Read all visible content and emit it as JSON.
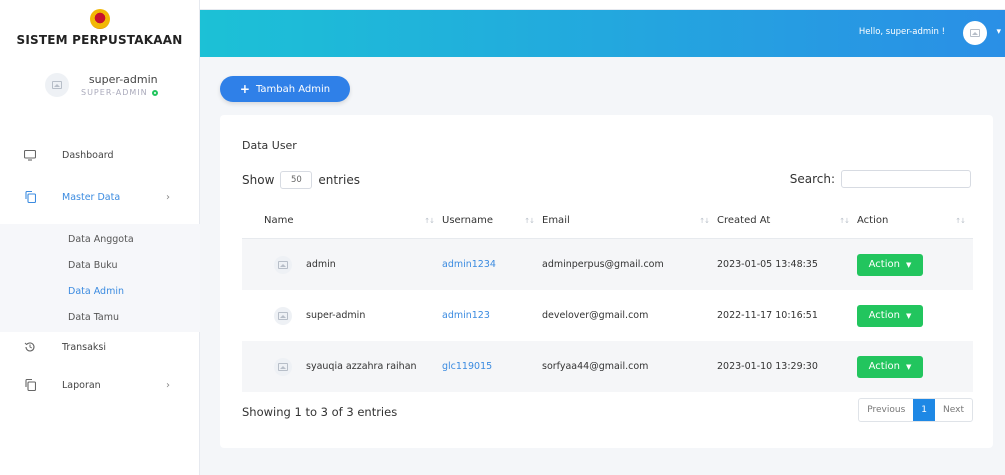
{
  "brand": {
    "title": "SISTEM PERPUSTAKAAN"
  },
  "profile": {
    "name": "super-admin",
    "role": "SUPER-ADMIN"
  },
  "sidebar": {
    "items": [
      {
        "label": "Dashboard"
      },
      {
        "label": "Master Data"
      },
      {
        "label": "Transaksi"
      },
      {
        "label": "Laporan"
      }
    ],
    "submenu": [
      {
        "label": "Data Anggota"
      },
      {
        "label": "Data Buku"
      },
      {
        "label": "Data Admin"
      },
      {
        "label": "Data Tamu"
      }
    ]
  },
  "header": {
    "greeting": "Hello, super-admin !"
  },
  "toolbar": {
    "add_label": "Tambah Admin"
  },
  "card": {
    "title": "Data User",
    "show_label": "Show",
    "entries_value": "50",
    "entries_label": "entries",
    "search_label": "Search:"
  },
  "table": {
    "headers": [
      "Name",
      "Username",
      "Email",
      "Created At",
      "Action"
    ],
    "rows": [
      {
        "name": "admin",
        "username": "admin1234",
        "email": "adminperpus@gmail.com",
        "created_at": "2023-01-05 13:48:35",
        "action": "Action"
      },
      {
        "name": "super-admin",
        "username": "admin123",
        "email": "develover@gmail.com",
        "created_at": "2022-11-17 10:16:51",
        "action": "Action"
      },
      {
        "name": "syauqia azzahra raihan",
        "username": "glc119015",
        "email": "sorfyaa44@gmail.com",
        "created_at": "2023-01-10 13:29:30",
        "action": "Action"
      }
    ]
  },
  "footer": {
    "info": "Showing 1 to 3 of 3 entries",
    "prev": "Previous",
    "page": "1",
    "next": "Next"
  },
  "colors": {
    "accent": "#2f80e8",
    "success": "#22c55e",
    "header_start": "#1cc1d6",
    "header_end": "#2a8fe6"
  }
}
